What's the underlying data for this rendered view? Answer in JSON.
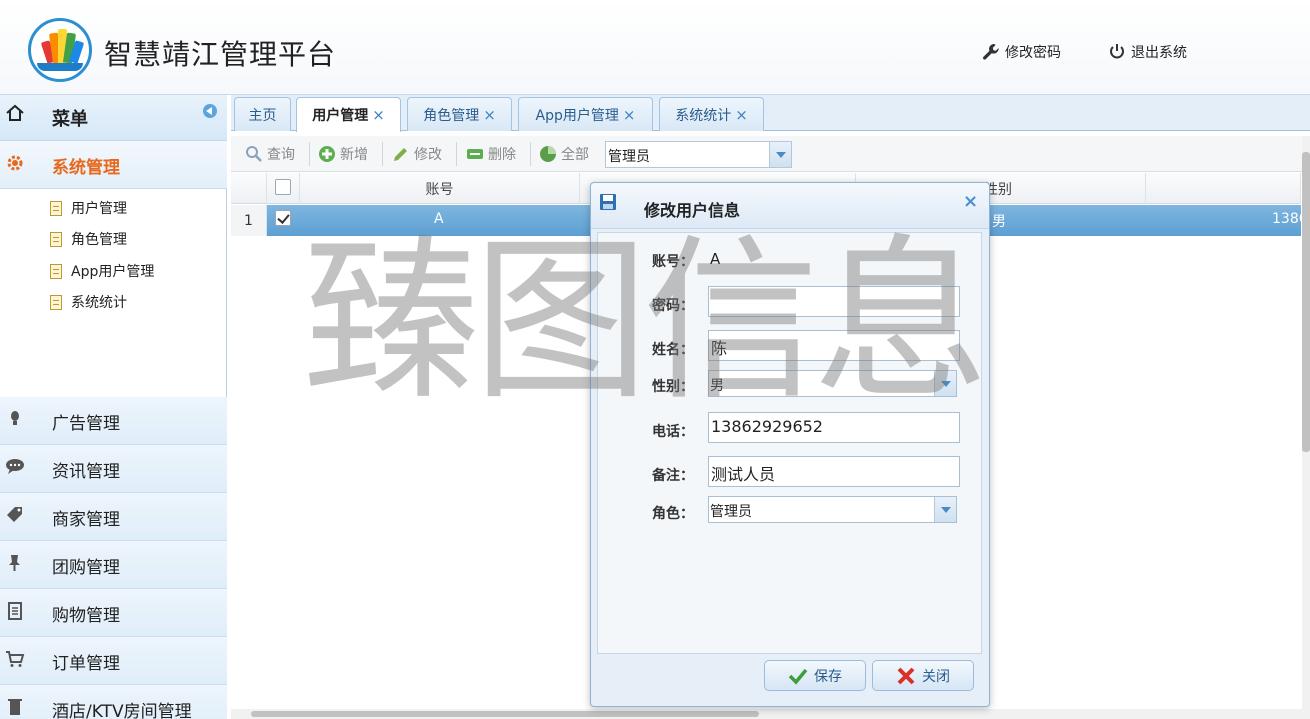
{
  "header": {
    "title": "智慧靖江管理平台",
    "change_password": "修改密码",
    "logout": "退出系统"
  },
  "sidebar": {
    "menu_label": "菜单",
    "active_group": "系统管理",
    "sub_items": [
      "用户管理",
      "角色管理",
      "App用户管理",
      "系统统计"
    ],
    "groups": [
      "广告管理",
      "资讯管理",
      "商家管理",
      "团购管理",
      "购物管理",
      "订单管理",
      "酒店/KTV房间管理"
    ]
  },
  "tabs": [
    {
      "label": "主页",
      "closable": false,
      "active": false
    },
    {
      "label": "用户管理",
      "closable": true,
      "active": true
    },
    {
      "label": "角色管理",
      "closable": true,
      "active": false
    },
    {
      "label": "App用户管理",
      "closable": true,
      "active": false
    },
    {
      "label": "系统统计",
      "closable": true,
      "active": false
    }
  ],
  "tab_close_glyph": "×",
  "toolbar": {
    "query": "查询",
    "add": "新增",
    "edit": "修改",
    "delete": "删除",
    "all": "全部",
    "role_filter": "管理员"
  },
  "grid": {
    "columns": [
      "账号",
      "性别"
    ],
    "rows": [
      {
        "num": "1",
        "account": "A",
        "gender": "男",
        "phone_partial": "1386",
        "checked": true
      }
    ]
  },
  "watermark": "臻图信息",
  "dialog": {
    "title": "修改用户信息",
    "close_glyph": "×",
    "fields": {
      "account_label": "账号：",
      "account_value": "A",
      "password_label": "密码：",
      "password_value": "",
      "name_label": "姓名：",
      "name_value": "陈",
      "gender_label": "性别：",
      "gender_value": "男",
      "phone_label": "电话：",
      "phone_value": "13862929652",
      "remark_label": "备注：",
      "remark_value": "测试人员",
      "role_label": "角色：",
      "role_value": "管理员"
    },
    "save_label": "保存",
    "close_label": "关闭"
  },
  "colors": {
    "accent": "#2b8fd1",
    "active_menu": "#e8691e",
    "selected_row": "#6aa8d8"
  }
}
